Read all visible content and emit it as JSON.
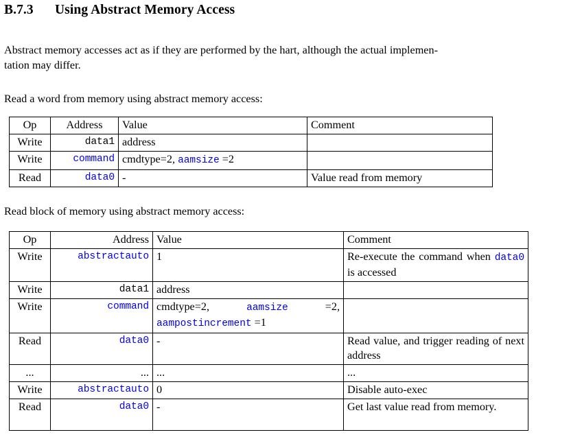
{
  "heading": {
    "number": "B.7.3",
    "title": "Using Abstract Memory Access"
  },
  "intro_paragraph": {
    "line1": "Abstract memory accesses act as if they are performed by the hart, although the actual implemen-",
    "line2": "tation may differ."
  },
  "captions": {
    "word_read": "Read a word from memory using abstract memory access:",
    "block_read": "Read block of memory using abstract memory access:"
  },
  "link_color": "#0000ee",
  "table_word_read": {
    "headers": {
      "op": "Op",
      "address": "Address",
      "value": "Value",
      "comment": "Comment"
    },
    "rows": [
      {
        "op": "Write",
        "address": "data1",
        "address_is_link": false,
        "value_plain": "address",
        "comment": ""
      },
      {
        "op": "Write",
        "address": "command",
        "address_is_link": true,
        "value_part1": "cmdtype=2, ",
        "value_link": "aamsize",
        "value_part2": " =2",
        "comment": ""
      },
      {
        "op": "Read",
        "address": "data0",
        "address_is_link": true,
        "value_plain": "-",
        "comment": "Value read from memory"
      }
    ]
  },
  "table_block_read": {
    "headers": {
      "op": "Op",
      "address": "Address",
      "value": "Value",
      "comment": "Comment"
    },
    "rows": [
      {
        "op": "Write",
        "address": "abstractauto",
        "value": "1",
        "comment_part1": "Re-execute the command when ",
        "comment_link": "data0",
        "comment_part2": " is accessed"
      },
      {
        "op": "Write",
        "address": "data1",
        "value": "address",
        "comment": ""
      },
      {
        "op": "Write",
        "address": "command",
        "value_part1": "cmdtype=2, ",
        "value_link1": "aamsize",
        "value_part2": " =2, ",
        "value_link2": "aampostincrement",
        "value_part3": " =1",
        "comment": ""
      },
      {
        "op": "Read",
        "address": "data0",
        "value": "-",
        "comment": "Read value, and trigger reading of next address"
      },
      {
        "op": "...",
        "address": "...",
        "value": "...",
        "comment": "..."
      },
      {
        "op": "Write",
        "address": "abstractauto",
        "value": "0",
        "comment": "Disable auto-exec"
      },
      {
        "op": "Read",
        "address": "data0",
        "value": "-",
        "comment": "Get last value read from memory."
      }
    ]
  }
}
